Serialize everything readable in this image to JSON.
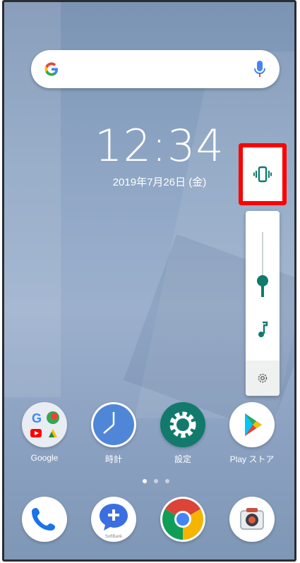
{
  "search": {
    "logo": "G"
  },
  "clock": {
    "time": "12:34",
    "date": "2019年7月26日 (金)"
  },
  "volume": {
    "mode_icon": "vibrate-icon",
    "media_icon": "music-note-icon",
    "settings_icon": "gear-icon",
    "level": 0.25,
    "highlight_color": "#ff0000",
    "accent_color": "#117a6d"
  },
  "apps": [
    {
      "label": "Google",
      "icon": "google-folder-icon"
    },
    {
      "label": "時計",
      "icon": "clock-icon"
    },
    {
      "label": "設定",
      "icon": "gear-icon"
    },
    {
      "label": "Play ストア",
      "icon": "play-store-icon"
    }
  ],
  "page_indicator": {
    "count": 3,
    "active": 0
  },
  "dock": [
    {
      "icon": "phone-icon"
    },
    {
      "icon": "messenger-icon",
      "badge": "SoftBank"
    },
    {
      "icon": "chrome-icon"
    },
    {
      "icon": "camera-icon"
    }
  ]
}
